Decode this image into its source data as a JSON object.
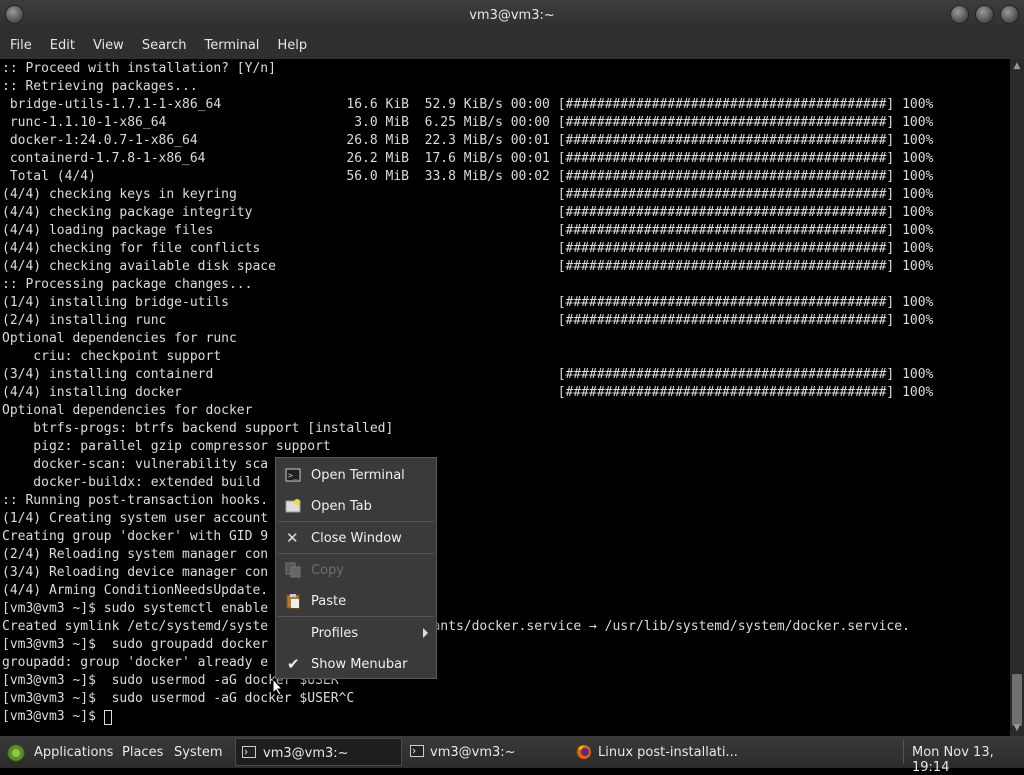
{
  "window": {
    "title": "vm3@vm3:~"
  },
  "menubar": [
    "File",
    "Edit",
    "View",
    "Search",
    "Terminal",
    "Help"
  ],
  "terminal": {
    "lines": [
      ":: Proceed with installation? [Y/n]",
      ":: Retrieving packages...",
      " bridge-utils-1.7.1-1-x86_64                16.6 KiB  52.9 KiB/s 00:00 [#########################################] 100%",
      " runc-1.1.10-1-x86_64                        3.0 MiB  6.25 MiB/s 00:00 [#########################################] 100%",
      " docker-1:24.0.7-1-x86_64                   26.8 MiB  22.3 MiB/s 00:01 [#########################################] 100%",
      " containerd-1.7.8-1-x86_64                  26.2 MiB  17.6 MiB/s 00:01 [#########################################] 100%",
      " Total (4/4)                                56.0 MiB  33.8 MiB/s 00:02 [#########################################] 100%",
      "(4/4) checking keys in keyring                                         [#########################################] 100%",
      "(4/4) checking package integrity                                       [#########################################] 100%",
      "(4/4) loading package files                                            [#########################################] 100%",
      "(4/4) checking for file conflicts                                      [#########################################] 100%",
      "(4/4) checking available disk space                                    [#########################################] 100%",
      ":: Processing package changes...",
      "(1/4) installing bridge-utils                                          [#########################################] 100%",
      "(2/4) installing runc                                                  [#########################################] 100%",
      "Optional dependencies for runc",
      "    criu: checkpoint support",
      "(3/4) installing containerd                                            [#########################################] 100%",
      "(4/4) installing docker                                                [#########################################] 100%",
      "Optional dependencies for docker",
      "    btrfs-progs: btrfs backend support [installed]",
      "    pigz: parallel gzip compressor support",
      "    docker-scan: vulnerability sca",
      "    docker-buildx: extended build",
      ":: Running post-transaction hooks.",
      "(1/4) Creating system user account",
      "Creating group 'docker' with GID 9",
      "(2/4) Reloading system manager con",
      "(3/4) Reloading device manager con",
      "(4/4) Arming ConditionNeedsUpdate.",
      "[vm3@vm3 ~]$ sudo systemctl enable",
      "Created symlink /etc/systemd/syste                    wants/docker.service → /usr/lib/systemd/system/docker.service.",
      "[vm3@vm3 ~]$  sudo groupadd docker",
      "groupadd: group 'docker' already e",
      "[vm3@vm3 ~]$  sudo usermod -aG docker $USER",
      "[vm3@vm3 ~]$  sudo usermod -aG docker $USER^C",
      "[vm3@vm3 ~]$ "
    ]
  },
  "context_menu": {
    "items": [
      {
        "label": "Open Terminal",
        "icon": "terminal-icon",
        "enabled": true
      },
      {
        "label": "Open Tab",
        "icon": "new-tab-icon",
        "enabled": true
      },
      {
        "label": "Close Window",
        "icon": "close-icon",
        "enabled": true
      },
      {
        "label": "Copy",
        "icon": "copy-icon",
        "enabled": false
      },
      {
        "label": "Paste",
        "icon": "paste-icon",
        "enabled": true
      },
      {
        "label": "Profiles",
        "icon": "",
        "enabled": true,
        "submenu": true
      },
      {
        "label": "Show Menubar",
        "icon": "checkmark-icon",
        "enabled": true,
        "checked": true
      }
    ]
  },
  "taskbar": {
    "menus": [
      "Applications",
      "Places",
      "System"
    ],
    "tasks": [
      {
        "label": "vm3@vm3:~",
        "icon": "terminal-icon",
        "active": true
      },
      {
        "label": "vm3@vm3:~",
        "icon": "terminal-icon",
        "active": false
      },
      {
        "label": "Linux post-installati...",
        "icon": "firefox-icon",
        "active": false
      }
    ],
    "clock": "Mon Nov 13, 19:14"
  },
  "colors": {
    "terminal_bg": "#000000",
    "terminal_fg": "#dcdcdc",
    "menu_bg": "#3a3a3a",
    "panel_bg": "#2f2f2f"
  }
}
